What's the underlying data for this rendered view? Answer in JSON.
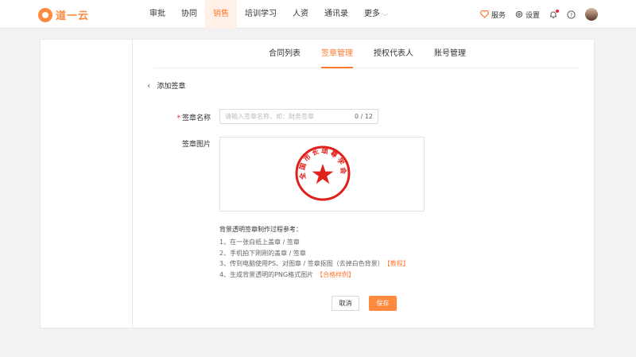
{
  "brand": {
    "name": "道一云",
    "color": "#ff8a3d"
  },
  "nav": {
    "items": [
      {
        "label": "审批"
      },
      {
        "label": "协同"
      },
      {
        "label": "销售",
        "active": true
      },
      {
        "label": "培训学习"
      },
      {
        "label": "人资"
      },
      {
        "label": "通讯录"
      },
      {
        "label": "更多"
      }
    ]
  },
  "tools": {
    "service": "服务",
    "settings": "设置"
  },
  "tabs": [
    {
      "label": "合同列表"
    },
    {
      "label": "签章管理",
      "active": true
    },
    {
      "label": "授权代表人"
    },
    {
      "label": "账号管理"
    }
  ],
  "page": {
    "back_label": "添加签章"
  },
  "form": {
    "name_label": "签章名称",
    "name_required": "*",
    "name_placeholder": "请输入签章名称，如：财务签章",
    "name_count": "0 / 12",
    "image_label": "签章图片"
  },
  "seal": {
    "text": "全国市长琐尊学会",
    "color": "#e0201b"
  },
  "guide": {
    "title": "背景透明签章制作过程参考：",
    "steps": [
      "1、在一张白纸上盖章 / 签章",
      "2、手机拍下刚刚的盖章 / 签章",
      "3、传到电脑使用PS、对图章 / 签章抠图（去掉白色背景）",
      "4、生成背景透明的PNG格式图片"
    ],
    "link_tutorial": "【教程】",
    "link_sample": "【合格样例】"
  },
  "buttons": {
    "cancel": "取消",
    "save": "保存"
  },
  "colors": {
    "accent": "#ff7a2f",
    "danger": "#f5222d"
  }
}
